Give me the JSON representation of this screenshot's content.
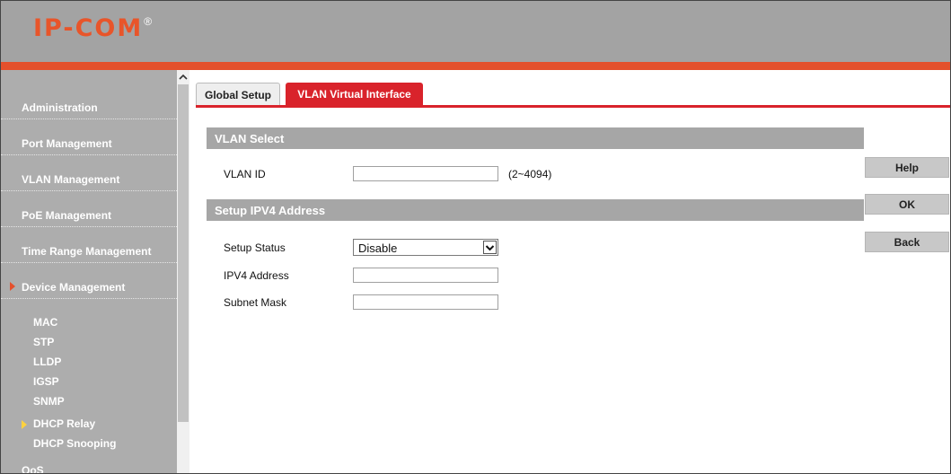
{
  "header": {
    "logo_text": "IP-COM",
    "logo_mark": "®",
    "brand_color": "#e8552a",
    "accent_color": "#e4502c"
  },
  "sidebar": {
    "scroll_up_icon": "chevron-up-icon",
    "items": [
      {
        "label": "Administration"
      },
      {
        "label": "Port Management"
      },
      {
        "label": "VLAN Management"
      },
      {
        "label": "PoE Management"
      },
      {
        "label": "Time Range Management"
      },
      {
        "label": "Device Management",
        "expanded": true
      }
    ],
    "subitems": [
      {
        "label": "MAC"
      },
      {
        "label": "STP"
      },
      {
        "label": "LLDP"
      },
      {
        "label": "IGSP"
      },
      {
        "label": "SNMP"
      },
      {
        "label": "DHCP Relay",
        "active": true
      },
      {
        "label": "DHCP Snooping"
      }
    ],
    "partial_item": {
      "label": "QoS"
    }
  },
  "tabs": [
    {
      "label": "Global Setup",
      "active": false
    },
    {
      "label": "VLAN Virtual Interface",
      "active": true
    }
  ],
  "tab_active_color": "#d9232b",
  "sections": {
    "vlan_select": {
      "title": "VLAN Select",
      "vlan_id_label": "VLAN ID",
      "vlan_id_value": "",
      "vlan_id_hint": "(2~4094)"
    },
    "ipv4": {
      "title": "Setup IPV4 Address",
      "status_label": "Setup Status",
      "status_value": "Disable",
      "address_label": "IPV4 Address",
      "address_value": "",
      "mask_label": "Subnet Mask",
      "mask_value": ""
    }
  },
  "buttons": {
    "help": "Help",
    "ok": "OK",
    "back": "Back"
  }
}
